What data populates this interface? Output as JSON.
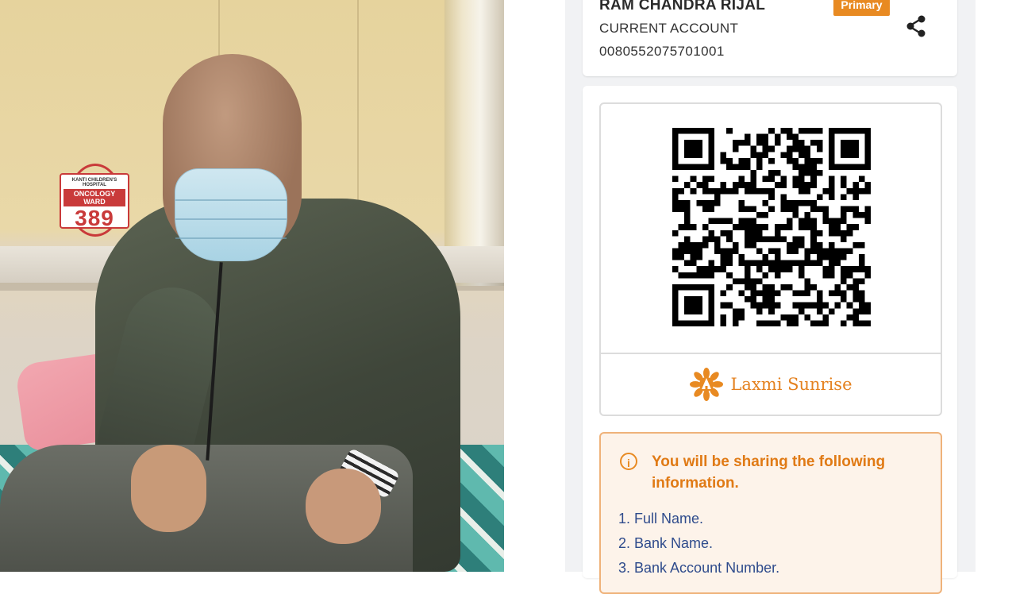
{
  "photo": {
    "ward_sign": {
      "hospital": "KANTI CHILDREN'S HOSPITAL",
      "ward_name": "ONCOLOGY WARD",
      "number": "389"
    }
  },
  "account": {
    "holder_name": "RAM CHANDRA RIJAL",
    "badge": "Primary",
    "type": "CURRENT ACCOUNT",
    "number": "0080552075701001",
    "share_icon": "share-icon"
  },
  "qr": {
    "bank_name": "Laxmi Sunrise",
    "bank_logo_icon": "lotus-logo-icon"
  },
  "info": {
    "icon": "info-icon",
    "icon_glyph": "i",
    "title": "You will be sharing the following information.",
    "items": [
      "1. Full Name.",
      "2. Bank Name.",
      "3. Bank Account Number."
    ]
  },
  "colors": {
    "accent_orange": "#e88a22",
    "info_text": "#e07a15",
    "list_text": "#2f4b8c"
  }
}
